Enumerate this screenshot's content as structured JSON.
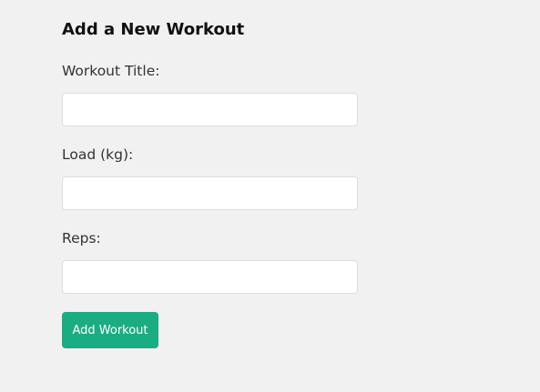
{
  "form": {
    "heading": "Add a New Workout",
    "fields": [
      {
        "label": "Workout Title:",
        "value": "",
        "placeholder": ""
      },
      {
        "label": "Load (kg):",
        "value": "",
        "placeholder": ""
      },
      {
        "label": "Reps:",
        "value": "",
        "placeholder": ""
      }
    ],
    "submit_label": "Add Workout"
  },
  "colors": {
    "page_background": "#f1f1f1",
    "accent": "#1aac83",
    "input_background": "#ffffff",
    "input_border": "#dddddd"
  }
}
